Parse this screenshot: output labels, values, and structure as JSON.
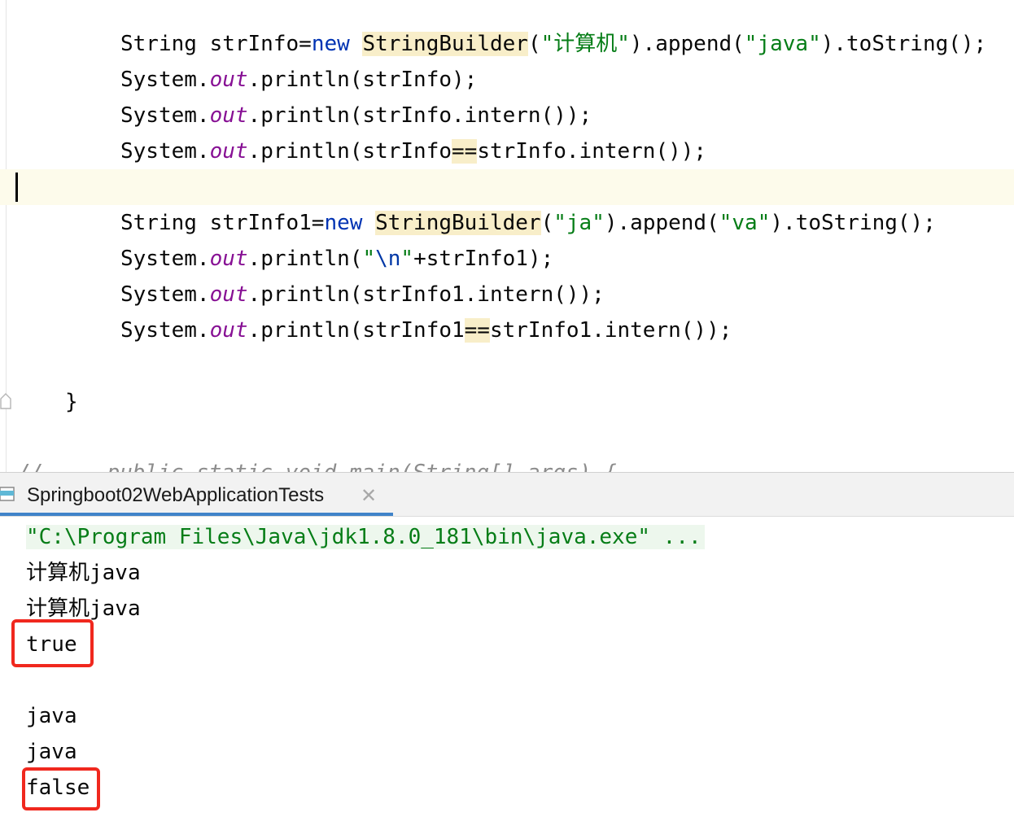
{
  "editor": {
    "lines": [
      {
        "a": "String strInfo=",
        "kw": "new",
        "sp": " ",
        "cls": "StringBuilder",
        "b": "(",
        "s1": "\"计算机\"",
        "c": ").append(",
        "s2": "\"java\"",
        "d": ").toString();"
      },
      {
        "a": "System.",
        "field": "out",
        "b": ".println(strInfo);"
      },
      {
        "a": "System.",
        "field": "out",
        "b": ".println(strInfo.intern());"
      },
      {
        "a": "System.",
        "field": "out",
        "b": ".println(strInfo",
        "op": "==",
        "c": "strInfo.intern());"
      },
      {
        "a": "String strInfo1=",
        "kw": "new",
        "sp": " ",
        "cls": "StringBuilder",
        "b": "(",
        "s1": "\"ja\"",
        "c": ").append(",
        "s2": "\"va\"",
        "d": ").toString();"
      },
      {
        "a": "System.",
        "field": "out",
        "b": ".println(",
        "s1": "\"",
        "esc": "\\n",
        "s2": "\"",
        "c": "+strInfo1);"
      },
      {
        "a": "System.",
        "field": "out",
        "b": ".println(strInfo1.intern());"
      },
      {
        "a": "System.",
        "field": "out",
        "b": ".println(strInfo1",
        "op": "==",
        "c": "strInfo1.intern());"
      }
    ],
    "closing_brace": "}",
    "cut_off_comment": "//     public static void main(String[] args) {"
  },
  "run": {
    "tab_label": "Springboot02WebApplicationTests",
    "close_glyph": "✕",
    "console": {
      "command": "\"C:\\Program Files\\Java\\jdk1.8.0_181\\bin\\java.exe\" ...",
      "out1": "计算机java",
      "out2": "计算机java",
      "out3": "true",
      "out4": "java",
      "out5": "java",
      "out6": "false"
    }
  },
  "colors": {
    "keyword": "#0033b3",
    "string": "#067d17",
    "static_field": "#871094",
    "highlight": "#f8eec9",
    "annotation_box": "#f0281e",
    "tab_underline": "#4083c9"
  },
  "icons": [
    "fold-icon",
    "run-tab-icon",
    "close-icon"
  ]
}
